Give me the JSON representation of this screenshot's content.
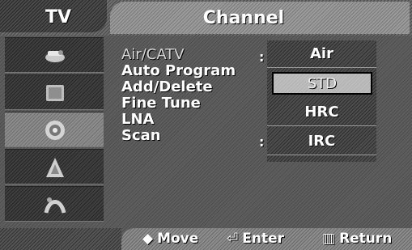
{
  "header": {
    "tab_left": "TV",
    "title": "Channel"
  },
  "sidebar": {
    "items": [
      {
        "icon": "picture-icon"
      },
      {
        "icon": "sound-icon"
      },
      {
        "icon": "channel-icon"
      },
      {
        "icon": "setup-icon"
      },
      {
        "icon": "input-icon"
      }
    ],
    "active_index": 2
  },
  "menu": {
    "items": [
      {
        "label": "Air/CATV"
      },
      {
        "label": "Auto Program"
      },
      {
        "label": "Add/Delete"
      },
      {
        "label": "Fine Tune"
      },
      {
        "label": "LNA"
      },
      {
        "label": "Scan"
      }
    ],
    "colon": ":"
  },
  "options": {
    "items": [
      "Air",
      "STD",
      "HRC",
      "IRC"
    ],
    "selected": "STD"
  },
  "footer": {
    "move": "Move",
    "enter": "Enter",
    "return": "Return",
    "move_icon": "◆",
    "enter_icon": "⏎",
    "return_icon": "▥"
  }
}
